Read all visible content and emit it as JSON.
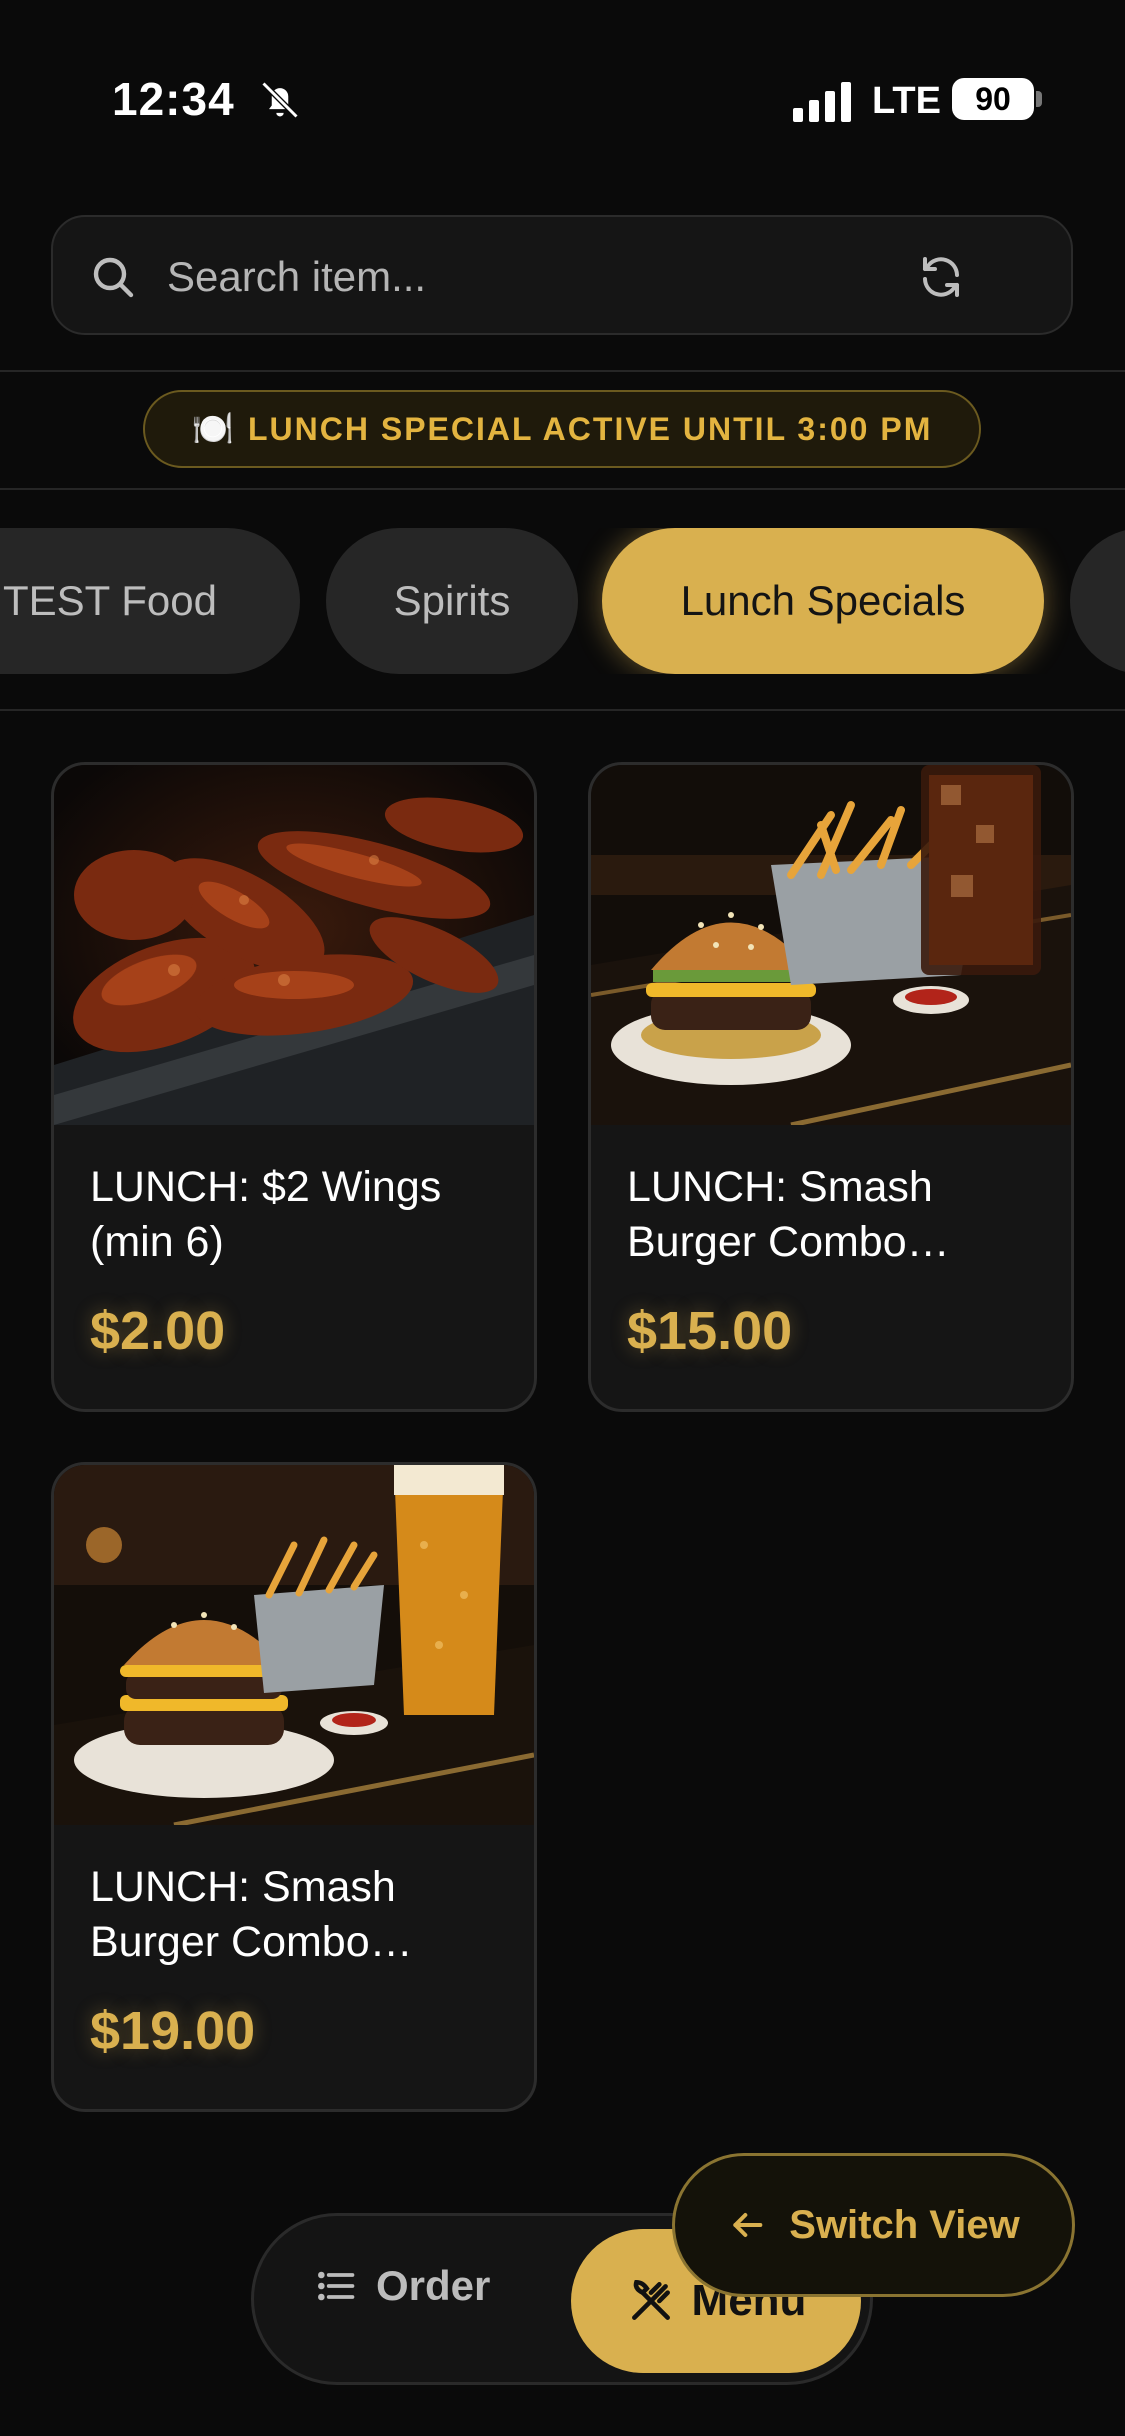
{
  "status_bar": {
    "time": "12:34",
    "network": "LTE",
    "battery": "90"
  },
  "search": {
    "placeholder": "Search item..."
  },
  "banner": {
    "emoji": "🍽️",
    "text": "LUNCH SPECIAL ACTIVE UNTIL 3:00 PM"
  },
  "tabs": [
    {
      "label": "TEST Food"
    },
    {
      "label": "Spirits"
    },
    {
      "label": "Lunch Specials",
      "active": true
    },
    {
      "label": ""
    }
  ],
  "items": [
    {
      "name": "LUNCH: $2 Wings (min 6)",
      "price": "$2.00",
      "image": "wings-image"
    },
    {
      "name": "LUNCH: Smash Burger Combo…",
      "price": "$15.00",
      "image": "burger-soda-image"
    },
    {
      "name": "LUNCH: Smash Burger Combo…",
      "price": "$19.00",
      "image": "burger-beer-image"
    }
  ],
  "bottom_nav": {
    "order_label": "Order",
    "menu_label": "Menu"
  },
  "switch_view": {
    "label": "Switch View"
  },
  "colors": {
    "accent": "#d9b04f",
    "background": "#0a0a0a",
    "card": "#151515"
  }
}
